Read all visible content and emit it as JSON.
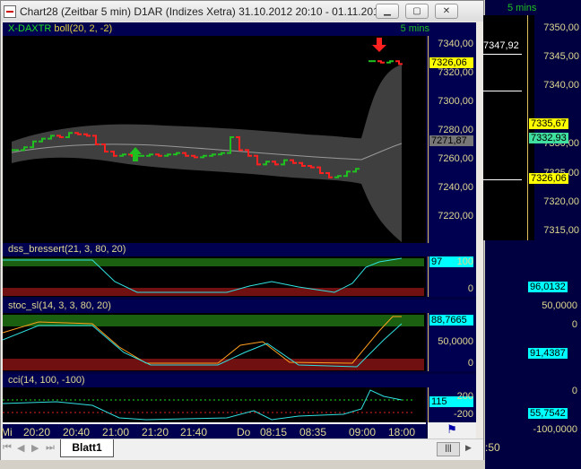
{
  "window": {
    "title": "Chart28 (Zeitbar 5 min)  D1AR (Indizes Xetra) 31.10.2012 20:10 - 01.11.2012 1...",
    "min": "▁",
    "max": "▢",
    "close": "✕"
  },
  "price_panel": {
    "symbol": "X-DAXTR",
    "indicator": "boll(20, 2, -2)",
    "interval": "5 mins",
    "ticks": [
      "7340,00",
      "7320,00",
      "7300,00",
      "7280,00",
      "7260,00",
      "7240,00",
      "7220,00"
    ],
    "last_price": "7326,06",
    "band_mid": "7271,87",
    "closes": [
      7266,
      7268,
      7272,
      7274,
      7276,
      7275,
      7278,
      7277,
      7276,
      7270,
      7265,
      7262,
      7263,
      7262,
      7262,
      7263,
      7262,
      7263,
      7264,
      7262,
      7261,
      7262,
      7263,
      7264,
      7275,
      7266,
      7262,
      7256,
      7258,
      7256,
      7259,
      7257,
      7255,
      7254,
      7250,
      7247,
      7248,
      7251,
      7253
    ],
    "late_closes": [
      7328,
      7327,
      7328,
      7326
    ]
  },
  "dss_panel": {
    "label": "dss_bressert(21, 3, 80, 20)",
    "value": "97",
    "ticks": [
      "100",
      "0"
    ]
  },
  "stoc_panel": {
    "label": "stoc_sl(14, 3, 3, 80, 20)",
    "value": "88,7665",
    "ticks": [
      "50,0000",
      "0"
    ]
  },
  "cci_panel": {
    "label": "cci(14, 100, -100)",
    "value": "115",
    "ticks": [
      "200",
      "-200"
    ]
  },
  "time_axis": [
    "Mi",
    "20:20",
    "20:40",
    "21:00",
    "21:20",
    "21:40",
    "Do",
    "08:15",
    "08:35",
    "09:00",
    "18:00"
  ],
  "sheet_tab": "Blatt1",
  "second_window": {
    "interval": "5 mins",
    "price_label": "7347,92",
    "ticks": [
      "7350,00",
      "7345,00",
      "7340,00",
      "7330,00",
      "7325,00",
      "7320,00",
      "7315,00"
    ],
    "tags": [
      "7335,67",
      "7332,93",
      "7326,06"
    ],
    "dss_value": "96,0132",
    "stoc_value": "91,4387",
    "stoc_tick": "50,0000",
    "cci_value": "55,7542",
    "cci_tick": "-100,0000",
    "zero": "0",
    "time": ":50"
  },
  "colors": {
    "up": "#20c020",
    "down": "#ff2020",
    "accent": "#ffff00",
    "cyan": "#00ffff"
  }
}
